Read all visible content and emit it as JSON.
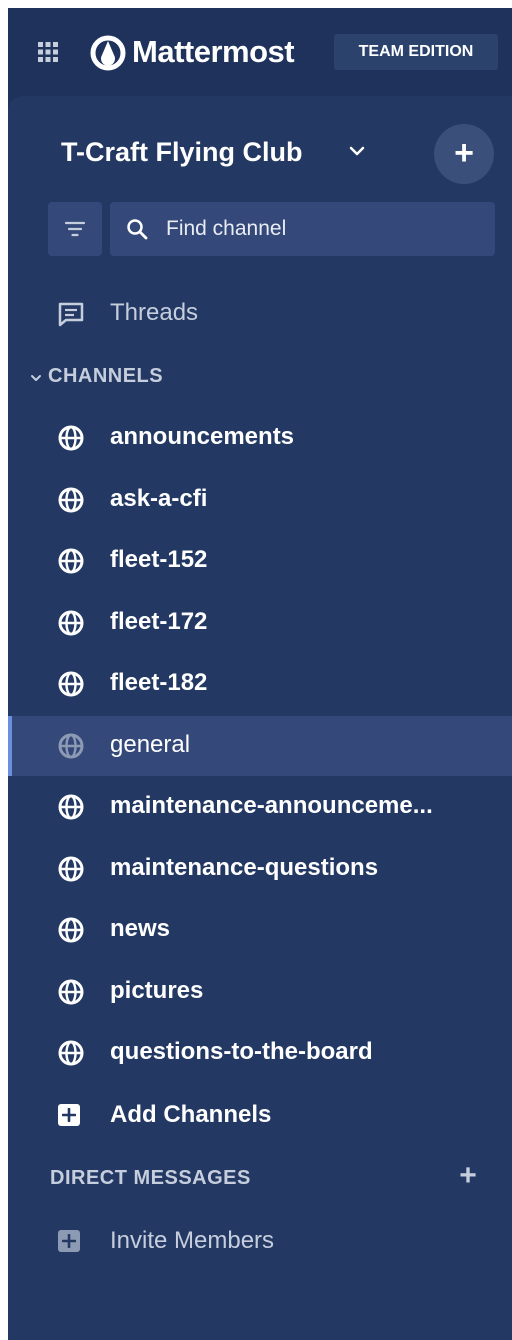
{
  "header": {
    "brand_name": "Mattermost",
    "edition_badge": "TEAM EDITION"
  },
  "team": {
    "name": "T-Craft Flying Club"
  },
  "search": {
    "placeholder": "Find channel"
  },
  "threads": {
    "label": "Threads"
  },
  "channels_section": {
    "title": "CHANNELS",
    "items": [
      {
        "label": "announcements"
      },
      {
        "label": "ask-a-cfi"
      },
      {
        "label": "fleet-152"
      },
      {
        "label": "fleet-172"
      },
      {
        "label": "fleet-182"
      },
      {
        "label": "general",
        "active": true
      },
      {
        "label": "maintenance-announceme..."
      },
      {
        "label": "maintenance-questions"
      },
      {
        "label": "news"
      },
      {
        "label": "pictures"
      },
      {
        "label": "questions-to-the-board"
      }
    ],
    "add_label": "Add Channels"
  },
  "dm_section": {
    "title": "DIRECT MESSAGES",
    "invite_label": "Invite Members"
  },
  "icons": {
    "app_grid": "grid-icon",
    "logo": "mattermost-logo-icon",
    "team_menu": "chevron-down-icon",
    "add_team": "plus-icon",
    "filter": "filter-icon",
    "search": "search-icon",
    "threads": "threads-icon",
    "channel": "globe-icon",
    "add_channel": "plus-box-icon"
  },
  "colors": {
    "frame_bg": "#1e325c",
    "sidebar_bg": "#233963",
    "active_row_bg": "#34497a",
    "active_indicator": "#6b8fe0",
    "text_primary": "#ffffff",
    "text_muted": "#c6cedd"
  }
}
